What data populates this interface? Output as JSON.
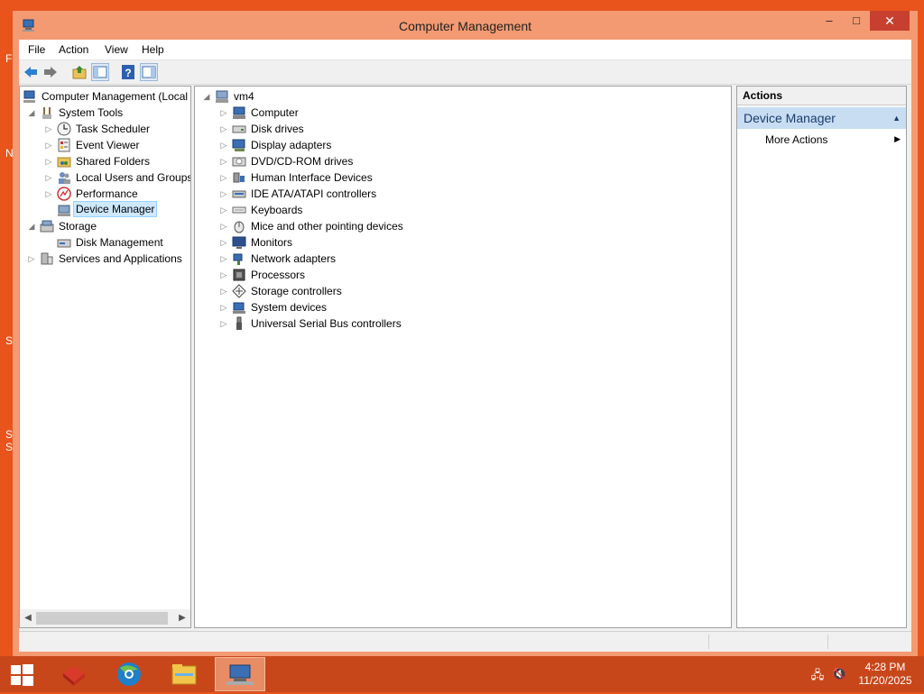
{
  "window": {
    "title": "Computer Management",
    "min_label": "–",
    "max_label": "□",
    "close_label": "✕"
  },
  "desktop_fragments": [
    "F",
    "N",
    "S",
    "SV",
    "St"
  ],
  "menu": [
    "File",
    "Action",
    "View",
    "Help"
  ],
  "toolbar": {
    "icons": [
      "back-icon",
      "forward-icon",
      "up-folder-icon",
      "show-hide-tree-icon",
      "help-icon",
      "show-hide-action-pane-icon"
    ]
  },
  "tree": {
    "root": "Computer Management (Local",
    "items": [
      {
        "label": "System Tools",
        "icon": "tools-icon"
      },
      {
        "label": "Task Scheduler",
        "icon": "clock-icon"
      },
      {
        "label": "Event Viewer",
        "icon": "event-viewer-icon"
      },
      {
        "label": "Shared Folders",
        "icon": "shared-folder-icon"
      },
      {
        "label": "Local Users and Groups",
        "icon": "users-icon"
      },
      {
        "label": "Performance",
        "icon": "performance-icon"
      },
      {
        "label": "Device Manager",
        "icon": "device-manager-icon"
      },
      {
        "label": "Storage",
        "icon": "storage-icon"
      },
      {
        "label": "Disk Management",
        "icon": "disk-management-icon"
      },
      {
        "label": "Services and Applications",
        "icon": "services-icon"
      }
    ],
    "selected": "Device Manager"
  },
  "devices": {
    "root": "vm4",
    "items": [
      {
        "label": "Computer",
        "icon": "computer-icon"
      },
      {
        "label": "Disk drives",
        "icon": "disk-drive-icon"
      },
      {
        "label": "Display adapters",
        "icon": "display-adapter-icon"
      },
      {
        "label": "DVD/CD-ROM drives",
        "icon": "dvd-drive-icon"
      },
      {
        "label": "Human Interface Devices",
        "icon": "hid-icon"
      },
      {
        "label": "IDE ATA/ATAPI controllers",
        "icon": "ide-controller-icon"
      },
      {
        "label": "Keyboards",
        "icon": "keyboard-icon"
      },
      {
        "label": "Mice and other pointing devices",
        "icon": "mouse-icon"
      },
      {
        "label": "Monitors",
        "icon": "monitor-icon"
      },
      {
        "label": "Network adapters",
        "icon": "network-adapter-icon"
      },
      {
        "label": "Processors",
        "icon": "processor-icon"
      },
      {
        "label": "Storage controllers",
        "icon": "storage-controller-icon"
      },
      {
        "label": "System devices",
        "icon": "system-devices-icon"
      },
      {
        "label": "Universal Serial Bus controllers",
        "icon": "usb-icon"
      }
    ]
  },
  "actions": {
    "header": "Actions",
    "section": "Device Manager",
    "items": [
      "More Actions"
    ]
  },
  "taskbar": {
    "apps": [
      "server-manager-icon",
      "browser-icon",
      "file-explorer-icon",
      "computer-management-icon"
    ],
    "active_app": "computer-management-icon",
    "time": "4:28 PM",
    "date": "11/20/2025"
  },
  "colors": {
    "desktop": "#e8541c",
    "window_frame": "#f39a72",
    "close_button": "#c7402f",
    "taskbar": "#c8471a",
    "selection": "#cde8ff",
    "actions_section": "#c8ddf2"
  }
}
